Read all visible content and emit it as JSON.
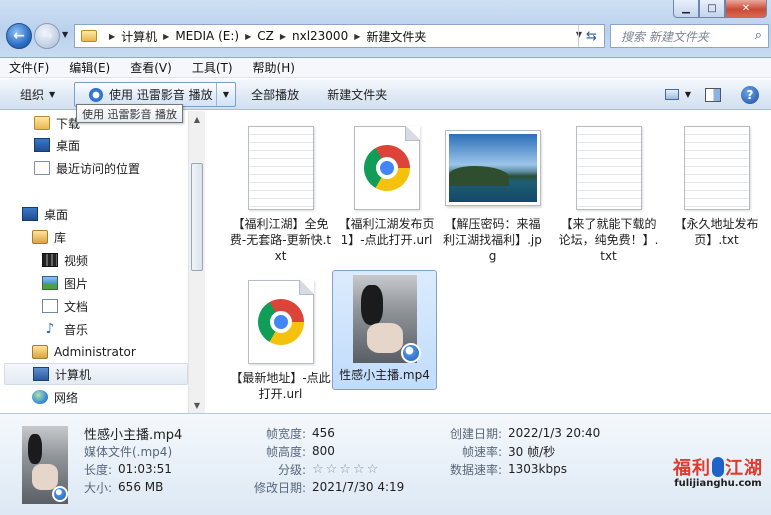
{
  "window": {
    "buttons": {
      "minimize": "▁",
      "maximize": "□",
      "close": "✕"
    }
  },
  "address": {
    "crumbs": [
      "计算机",
      "MEDIA (E:)",
      "CZ",
      "nxl23000",
      "新建文件夹"
    ]
  },
  "search": {
    "placeholder": "搜索 新建文件夹"
  },
  "menu": {
    "items": [
      "文件(F)",
      "编辑(E)",
      "查看(V)",
      "工具(T)",
      "帮助(H)"
    ]
  },
  "toolbar": {
    "organize": "组织",
    "play_with": "使用 迅雷影音 播放",
    "play_all": "全部播放",
    "new_folder": "新建文件夹",
    "tooltip": "使用 迅雷影音 播放"
  },
  "sidebar": {
    "items": [
      {
        "label": "下载",
        "icon": "download-folder-icon"
      },
      {
        "label": "桌面",
        "icon": "desktop-icon"
      },
      {
        "label": "最近访问的位置",
        "icon": "recent-places-icon"
      },
      {
        "label": "桌面",
        "icon": "desktop-icon"
      },
      {
        "label": "库",
        "icon": "library-icon"
      },
      {
        "label": "视频",
        "icon": "video-library-icon"
      },
      {
        "label": "图片",
        "icon": "pictures-library-icon"
      },
      {
        "label": "文档",
        "icon": "documents-library-icon"
      },
      {
        "label": "音乐",
        "icon": "music-library-icon"
      },
      {
        "label": "Administrator",
        "icon": "user-folder-icon"
      },
      {
        "label": "计算机",
        "icon": "computer-icon"
      },
      {
        "label": "网络",
        "icon": "network-icon"
      }
    ]
  },
  "files": [
    {
      "name": "【福利江湖】全免费-无套路-更新快.txt",
      "type": "txt"
    },
    {
      "name": "【福利江湖发布页1】-点此打开.url",
      "type": "url"
    },
    {
      "name": "【解压密码：来福利江湖找福利】.jpg",
      "type": "jpg"
    },
    {
      "name": "【来了就能下载的论坛，纯免费！】.txt",
      "type": "txt"
    },
    {
      "name": "【永久地址发布页】.txt",
      "type": "txt"
    },
    {
      "name": "【最新地址】-点此打开.url",
      "type": "url"
    },
    {
      "name": "性感小主播.mp4",
      "type": "mp4"
    }
  ],
  "details": {
    "filename": "性感小主播.mp4",
    "filetype": "媒体文件(.mp4)",
    "length_label": "长度:",
    "length": "01:03:51",
    "size_label": "大小:",
    "size": "656 MB",
    "width_label": "帧宽度:",
    "width": "456",
    "height_label": "帧高度:",
    "height": "800",
    "rating_label": "分级:",
    "rating": 0,
    "rating_stars": "☆☆☆☆☆",
    "modified_label": "修改日期:",
    "modified": "2021/7/30 4:19",
    "created_label": "创建日期:",
    "created": "2022/1/3 20:40",
    "fps_label": "帧速率:",
    "fps": "30 帧/秒",
    "bitrate_label": "数据速率:",
    "bitrate": "1303kbps"
  },
  "watermark": {
    "cn_left": "福利",
    "cn_right": "江湖",
    "en": "fulijianghu.com"
  },
  "colors": {
    "selection": "#c1dcfc",
    "accent": "#2c6fc6",
    "watermark_red": "#e23a2d"
  }
}
